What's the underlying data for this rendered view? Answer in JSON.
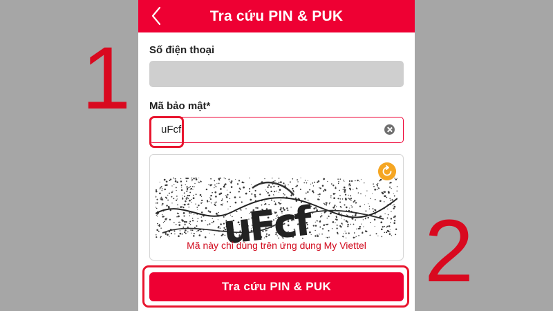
{
  "annotations": {
    "step_one": "1",
    "step_two": "2"
  },
  "header": {
    "title": "Tra cứu PIN & PUK",
    "back_icon": "chevron-left-icon"
  },
  "form": {
    "phone_label": "Số điện thoại",
    "phone_value": "",
    "code_label": "Mã bảo mật*",
    "code_value": "uFcf",
    "clear_icon": "clear-circle-icon"
  },
  "captcha": {
    "text": "uFcf",
    "note": "Mã này chỉ dùng trên ứng dụng My Viettel",
    "refresh_icon": "refresh-icon"
  },
  "submit": {
    "label": "Tra cứu PIN & PUK"
  },
  "colors": {
    "brand": "#ee0033",
    "background": "#a6a6a6",
    "annotation": "#d9091f",
    "refresh": "#f5a623"
  }
}
